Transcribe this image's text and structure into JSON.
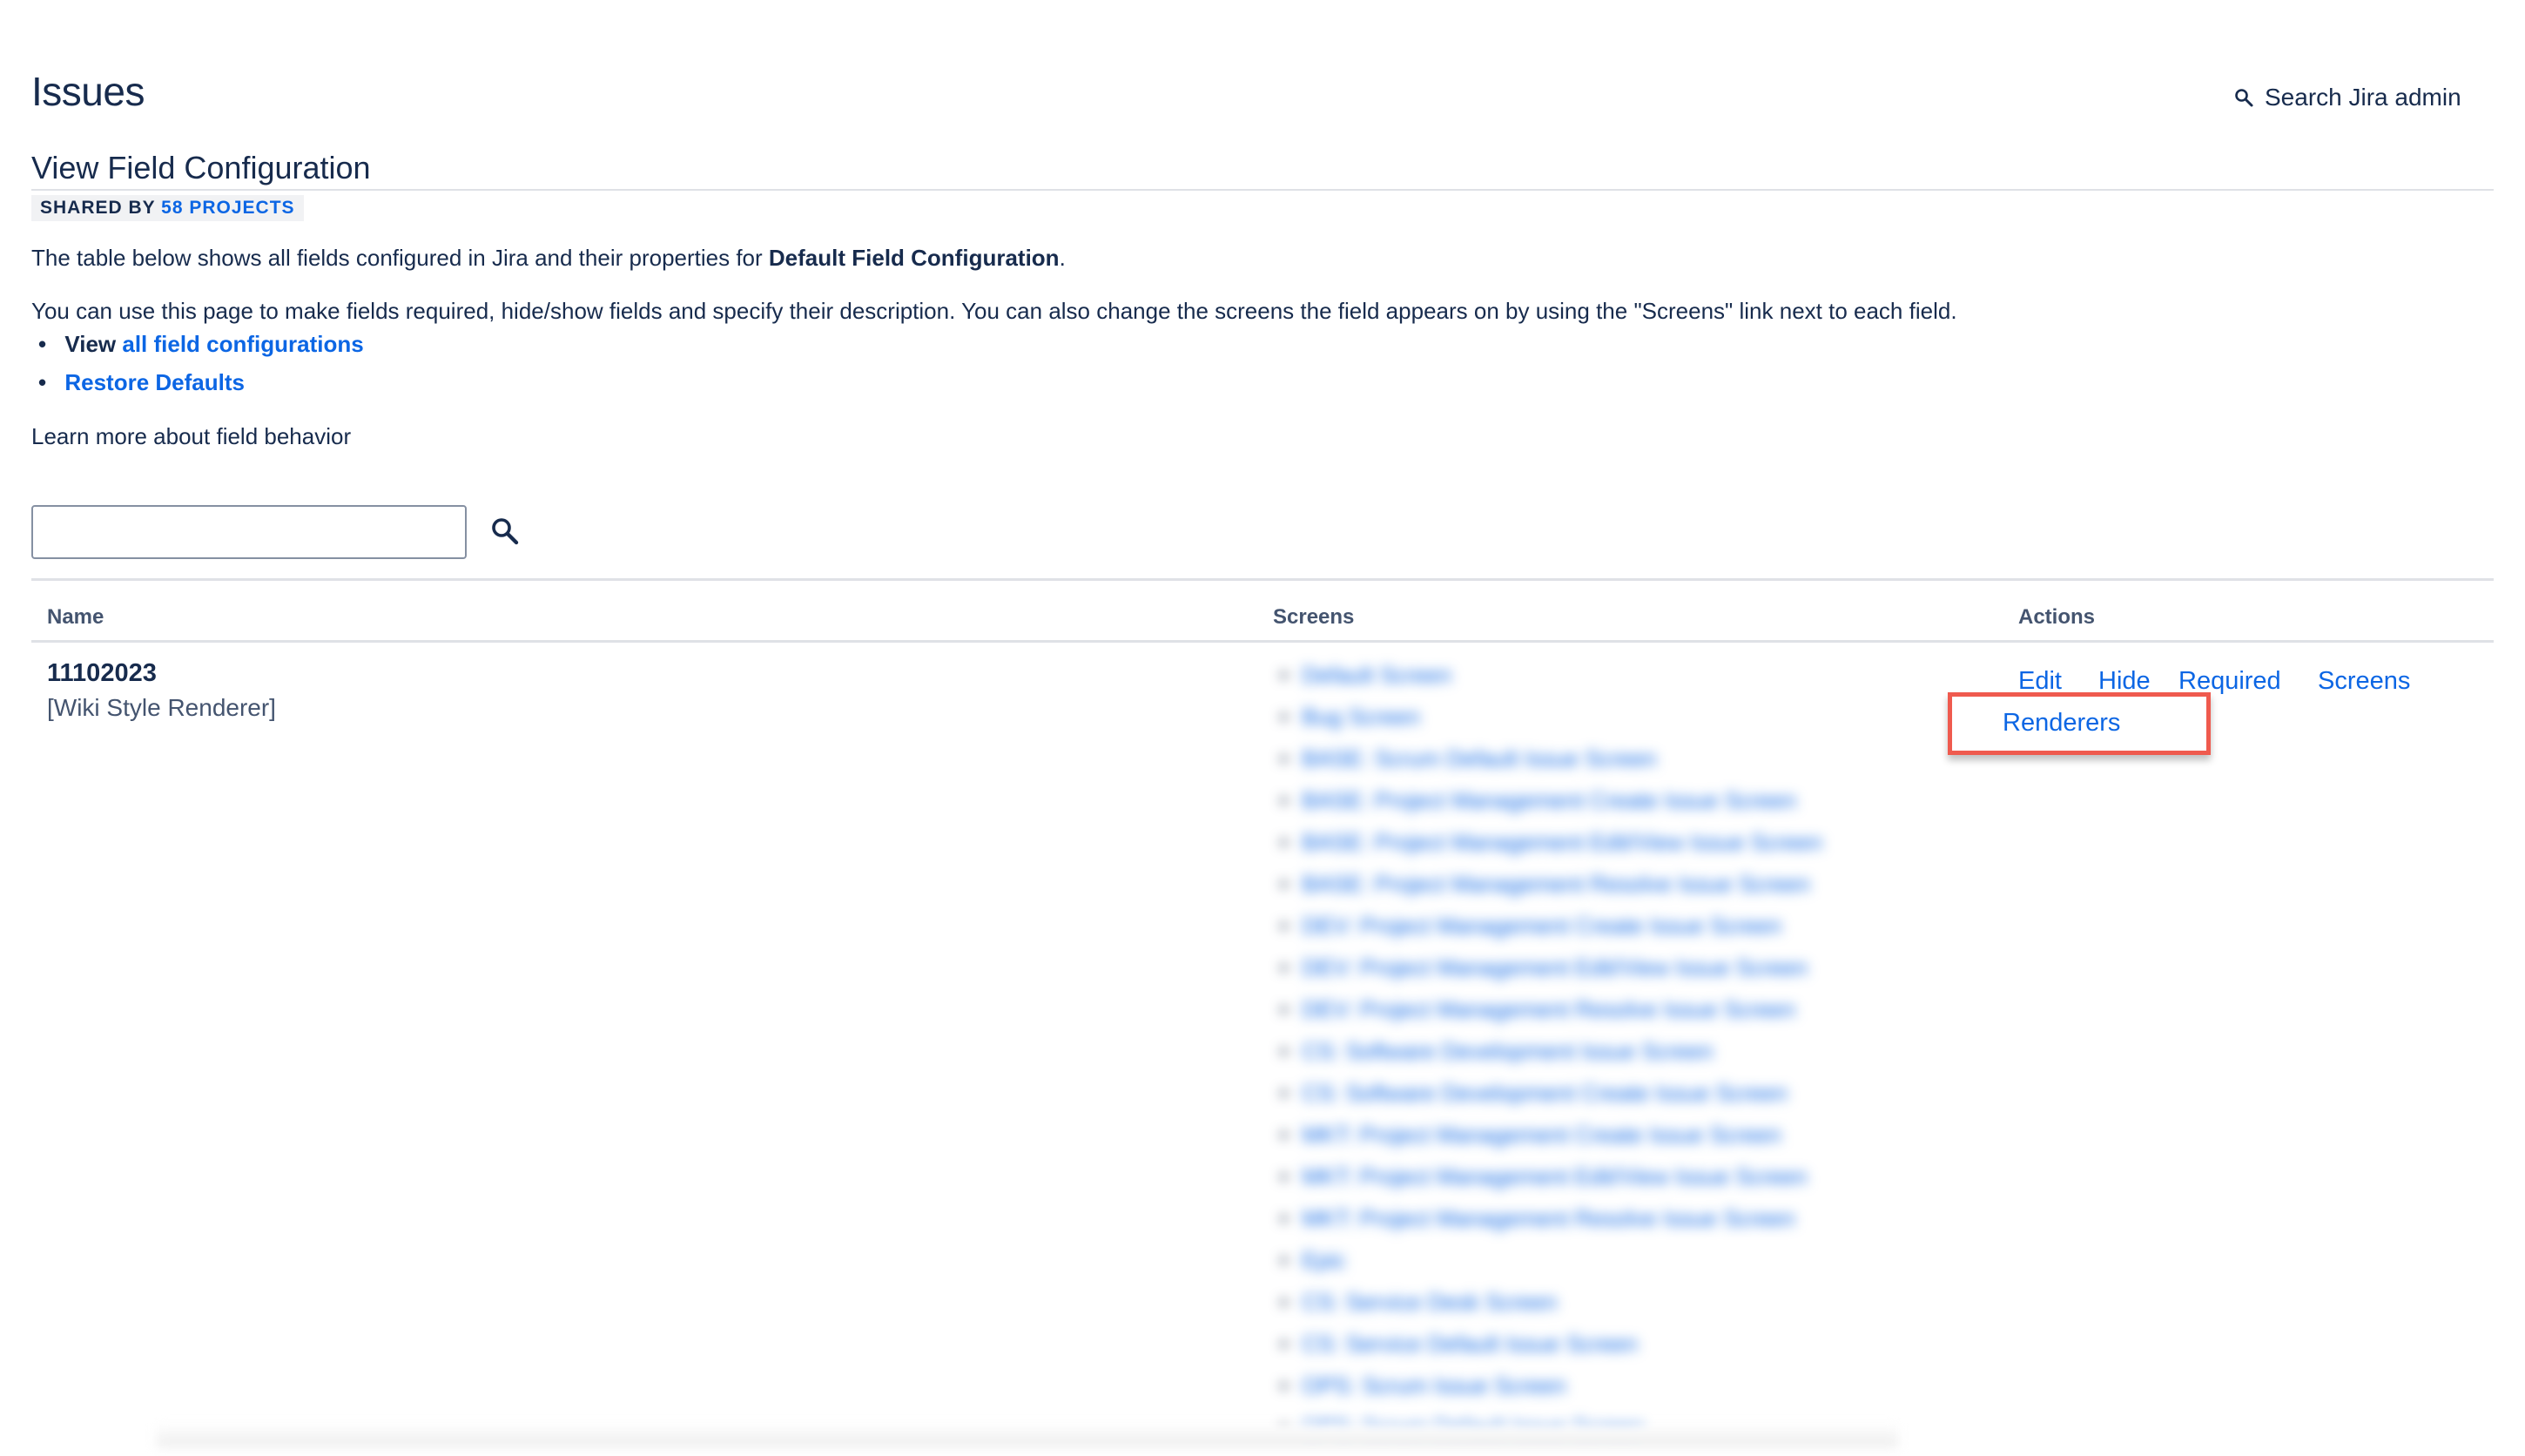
{
  "page": {
    "title": "Issues",
    "admin_search_label": "Search Jira admin",
    "subtitle": "View Field Configuration",
    "shared_prefix": "SHARED BY",
    "shared_projects": "58 PROJECTS"
  },
  "intro": {
    "line1_text": "The table below shows all fields configured in Jira and their properties for",
    "line1_bold": "Default Field Configuration",
    "line1_end": ".",
    "line2_text": "You can use this page to make fields required, hide/show fields and specify their description. You can also change the screens the field appears on by using the \"Screens\" link next to each field.",
    "bullet1_prefix": "View",
    "bullet1_link": "all field configurations",
    "bullet2_link": "Restore Defaults",
    "learn_more": "Learn more about field behavior"
  },
  "filter": {
    "value": "",
    "placeholder": ""
  },
  "table": {
    "headers": {
      "name": "Name",
      "screens": "Screens",
      "actions": "Actions"
    },
    "row": {
      "name": "11102023",
      "renderer": "[Wiki Style Renderer]",
      "screens": [
        "Default Screen",
        "Bug Screen",
        "BASE: Scrum Default Issue Screen",
        "BASE: Project Management Create Issue Screen",
        "BASE: Project Management Edit/View Issue Screen",
        "BASE: Project Management Resolve Issue Screen",
        "DEV: Project Management Create Issue Screen",
        "DEV: Project Management Edit/View Issue Screen",
        "DEV: Project Management Resolve Issue Screen",
        "CS: Software Development Issue Screen",
        "CS: Software Development Create Issue Screen",
        "MKT: Project Management Create Issue Screen",
        "MKT: Project Management Edit/View Issue Screen",
        "MKT: Project Management Resolve Issue Screen",
        "Epic",
        "CS: Service Desk Screen",
        "CS: Service Default Issue Screen",
        "OPS: Scrum Issue Screen",
        "OPS: Scrum Default Issue Screen"
      ],
      "actions": {
        "edit": "Edit",
        "hide": "Hide",
        "required": "Required",
        "screens": "Screens",
        "renderers": "Renderers"
      }
    }
  },
  "colors": {
    "link": "#0c66e4",
    "text": "#172b4d",
    "highlight": "#ef5a4e"
  }
}
